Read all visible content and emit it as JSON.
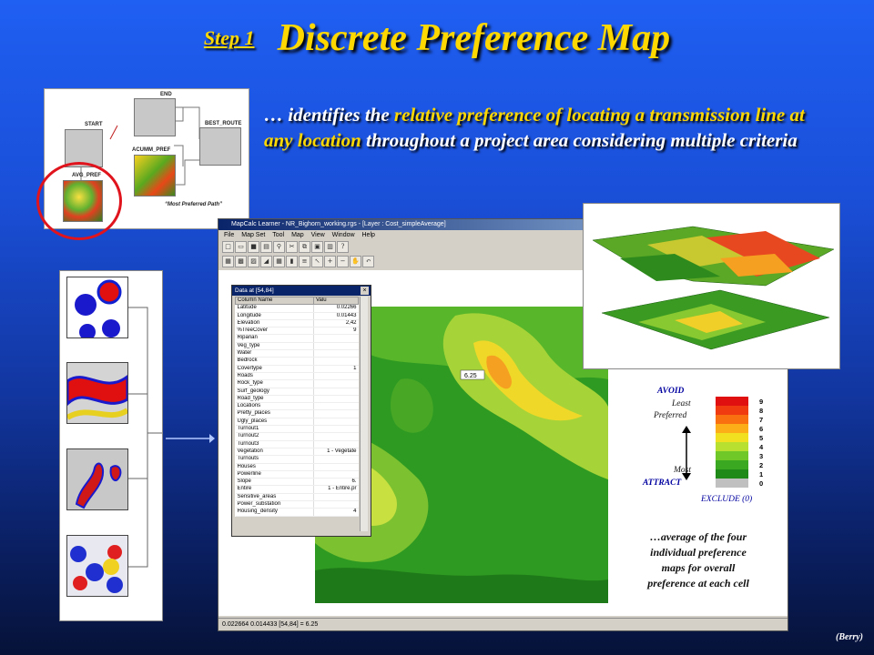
{
  "title": {
    "step": "Step 1",
    "main": "Discrete Preference Map"
  },
  "intro": {
    "p1": "… identifies the ",
    "p2": "relative preference of locating a transmission line at any location",
    "p3": " throughout a project area considering multiple criteria"
  },
  "flow": {
    "start": "START",
    "end": "END",
    "best_route": "BEST_ROUTE",
    "acumm_pref": "ACUMM_PREF",
    "avg_pref": "AVG_PREF",
    "note": "“Most Preferred Path”"
  },
  "app": {
    "window_title": "MapCalc Learner - NR_Bighorn_working.rgs - [Layer : Cost_simpleAverage]",
    "menu": [
      "File",
      "Map Set",
      "Tool",
      "Map",
      "View",
      "Window",
      "Help"
    ],
    "status": "0.022664    0.014433  [54,84] = 6.25",
    "cell_label": "6.25"
  },
  "dialog": {
    "title": "Data at [54,84]",
    "col_name": "Column Name",
    "col_value": "Valu",
    "rows": [
      {
        "name": "Latitude",
        "value": "0.02266"
      },
      {
        "name": "Longitude",
        "value": "0.01443"
      },
      {
        "name": "Elevation",
        "value": "2,42"
      },
      {
        "name": "%TreeCover",
        "value": "9"
      },
      {
        "name": "Riparian",
        "value": ""
      },
      {
        "name": "Veg_type",
        "value": ""
      },
      {
        "name": "Water",
        "value": ""
      },
      {
        "name": "Bedrock",
        "value": ""
      },
      {
        "name": "Covertype",
        "value": "1"
      },
      {
        "name": "Roads",
        "value": ""
      },
      {
        "name": "Rock_type",
        "value": ""
      },
      {
        "name": "Surf_geology",
        "value": ""
      },
      {
        "name": "Road_type",
        "value": ""
      },
      {
        "name": "Locations",
        "value": ""
      },
      {
        "name": "Pretty_places",
        "value": ""
      },
      {
        "name": "Ugly_places",
        "value": ""
      },
      {
        "name": "Turnout1",
        "value": ""
      },
      {
        "name": "Turnout2",
        "value": ""
      },
      {
        "name": "Turnout3",
        "value": ""
      },
      {
        "name": "Vegetation",
        "value": "1 - Vegetate"
      },
      {
        "name": "Turnouts",
        "value": ""
      },
      {
        "name": "Houses",
        "value": ""
      },
      {
        "name": "Powerline",
        "value": ""
      },
      {
        "name": "Slope",
        "value": "6."
      },
      {
        "name": "Entire",
        "value": "1 - Entire.pr"
      },
      {
        "name": "Sensitive_areas",
        "value": ""
      },
      {
        "name": "Power_substation",
        "value": ""
      },
      {
        "name": "Housing_density",
        "value": "4"
      }
    ]
  },
  "legend": {
    "avoid": "AVOID",
    "least": "Least",
    "preferred": "Preferred",
    "most": "Most",
    "attract": "ATTRACT",
    "exclude": "EXCLUDE (0)",
    "ticks": [
      "9",
      "8",
      "7",
      "6",
      "5",
      "4",
      "3",
      "2",
      "1",
      "0"
    ],
    "colors": [
      "#e01010",
      "#f03a10",
      "#f87010",
      "#fbae18",
      "#f0e020",
      "#b8e030",
      "#70c828",
      "#3aa820",
      "#208a18",
      "#c0c0c0"
    ]
  },
  "caption": [
    "…average of the four",
    "individual preference",
    "maps for overall",
    "preference at each cell"
  ],
  "credit": "(Berry)"
}
